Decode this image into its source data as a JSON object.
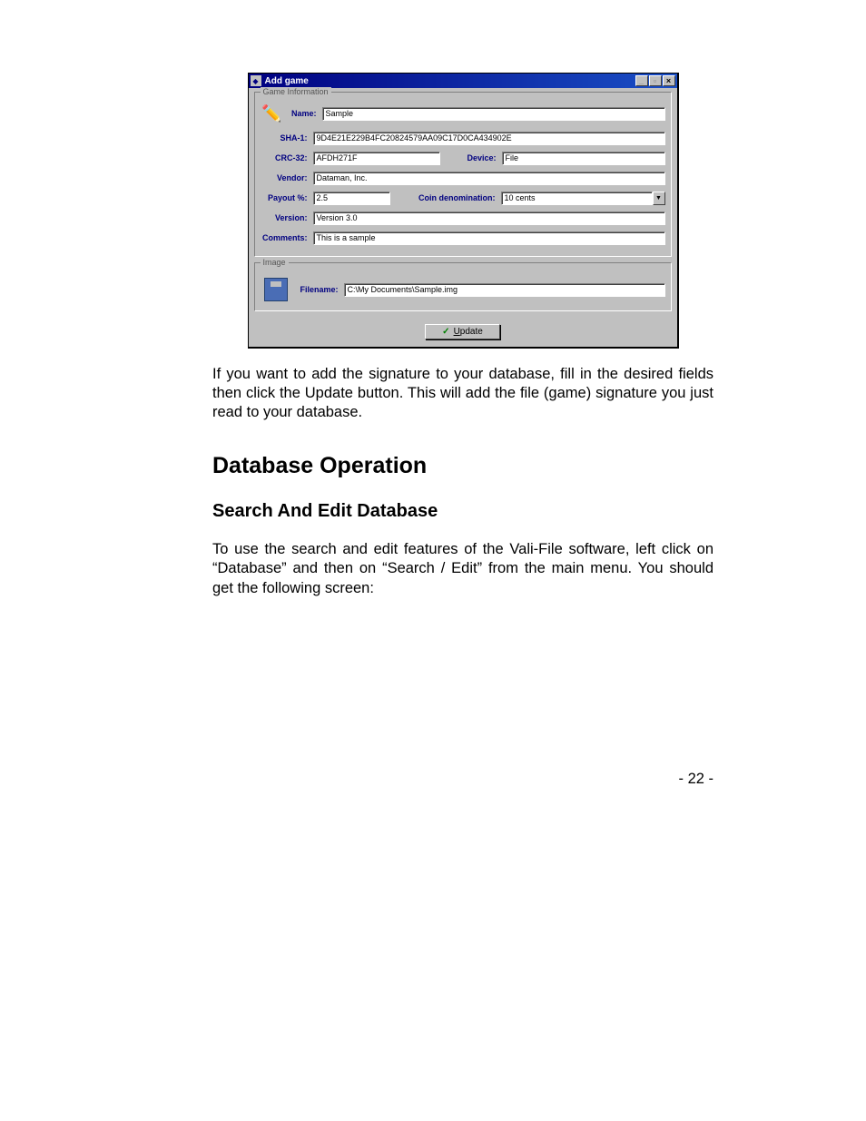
{
  "dialog": {
    "title": "Add game",
    "groups": {
      "gameInfo": "Game Information",
      "image": "Image"
    },
    "labels": {
      "name": "Name:",
      "sha1": "SHA-1:",
      "crc32": "CRC-32:",
      "device": "Device:",
      "vendor": "Vendor:",
      "payout": "Payout %:",
      "coinDenom": "Coin denomination:",
      "version": "Version:",
      "comments": "Comments:",
      "filename": "Filename:"
    },
    "fields": {
      "name": "Sample",
      "sha1": "9D4E21E229B4FC20824579AA09C17D0CA434902E",
      "crc32": "AFDH271F",
      "device": "File",
      "vendor": "Dataman, Inc.",
      "payout": "2.5",
      "coinDenom": "10 cents",
      "version": "Version 3.0",
      "comments": "This is a sample",
      "filename": "C:\\My Documents\\Sample.img"
    },
    "buttons": {
      "update": "Update"
    },
    "window": {
      "min": "_",
      "max": "▫",
      "close": "×"
    }
  },
  "doc": {
    "para1": "If you want to add the signature to your database, fill in the desired fields then click the Update button. This will add the file (game) signature you just read to your database.",
    "h1": "Database Operation",
    "h2": "Search And Edit Database",
    "para2": "To use the search and edit features of the Vali-File software, left click on “Database” and then on “Search / Edit” from the main menu. You should get the following screen:",
    "pageNum": "- 22 -"
  }
}
